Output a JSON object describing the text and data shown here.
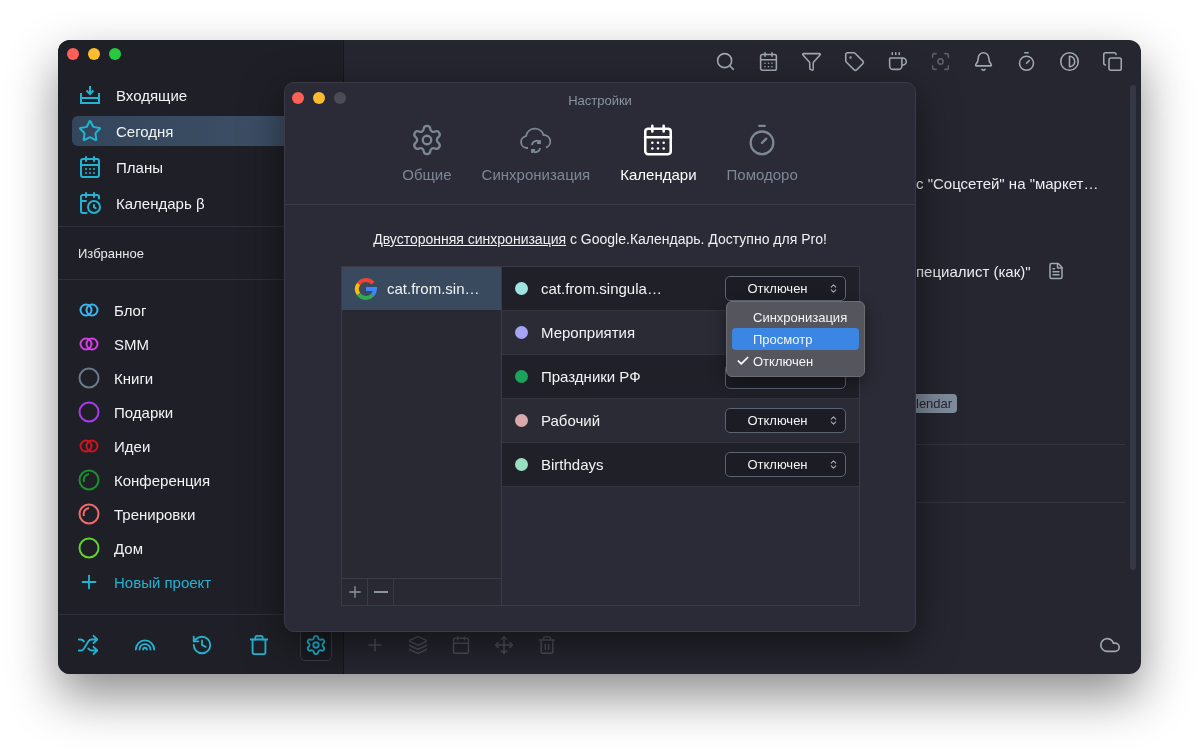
{
  "sidebar": {
    "nav": [
      {
        "label": "Входящие",
        "selected": false
      },
      {
        "label": "Сегодня",
        "selected": true
      },
      {
        "label": "Планы",
        "selected": false
      },
      {
        "label": "Календарь β",
        "selected": false
      }
    ],
    "favorites_heading": "Избранное",
    "projects": [
      {
        "label": "Блог",
        "kind": "double",
        "color": "#3db4ee"
      },
      {
        "label": "SMM",
        "kind": "double",
        "color": "#d63fe6"
      },
      {
        "label": "Книги",
        "kind": "ring",
        "color": "#6b7a8a"
      },
      {
        "label": "Подарки",
        "kind": "ring",
        "color": "#a53bea"
      },
      {
        "label": "Идеи",
        "kind": "double",
        "color": "#d0141e"
      },
      {
        "label": "Конференция",
        "kind": "progress",
        "color": "#1f8f2c"
      },
      {
        "label": "Тренировки",
        "kind": "progress",
        "color": "#f06a6a"
      },
      {
        "label": "Дом",
        "kind": "ring",
        "color": "#62d22c"
      }
    ],
    "new_project": "Новый проект",
    "toolbar": [
      {
        "selected": false
      },
      {
        "selected": false
      },
      {
        "selected": false
      },
      {
        "selected": false
      },
      {
        "selected": true
      }
    ]
  },
  "main": {
    "tasks": [
      {
        "title": "с \"Соцсетей\" на \"маркет…",
        "has_note": false
      },
      {
        "title": "пециалист (как)\"",
        "has_note": true
      }
    ],
    "tag": "lendar"
  },
  "settings": {
    "title": "Настройки",
    "tabs": [
      {
        "label": "Общие",
        "selected": false
      },
      {
        "label": "Синхронизация",
        "selected": false
      },
      {
        "label": "Календари",
        "selected": true
      },
      {
        "label": "Помодоро",
        "selected": false
      }
    ],
    "notice": {
      "link": "Двусторонняя синхронизация",
      "text": " с Google.Календарь. Доступно для Pro!"
    },
    "accounts": [
      {
        "name": "cat.from.sin…",
        "selected": true
      }
    ],
    "calendars": [
      {
        "name": "cat.from.singula…",
        "color": "#9fe3e3",
        "select_visible": true,
        "value": "Отключен"
      },
      {
        "name": "Мероприятия",
        "color": "#a5a3f5",
        "select_visible": false
      },
      {
        "name": "Праздники РФ",
        "color": "#1aa35a",
        "select_visible": true
      },
      {
        "name": "Рабочий",
        "color": "#d9a9ab",
        "select_visible": true,
        "value": "Отключен"
      },
      {
        "name": "Birthdays",
        "color": "#98e0bf",
        "select_visible": true,
        "value": "Отключен"
      }
    ],
    "popup": {
      "options": [
        {
          "label": "Синхронизация",
          "highlighted": false,
          "checked": false
        },
        {
          "label": "Просмотр",
          "highlighted": true,
          "checked": false
        },
        {
          "label": "Отключен",
          "highlighted": false,
          "checked": true
        }
      ]
    }
  }
}
